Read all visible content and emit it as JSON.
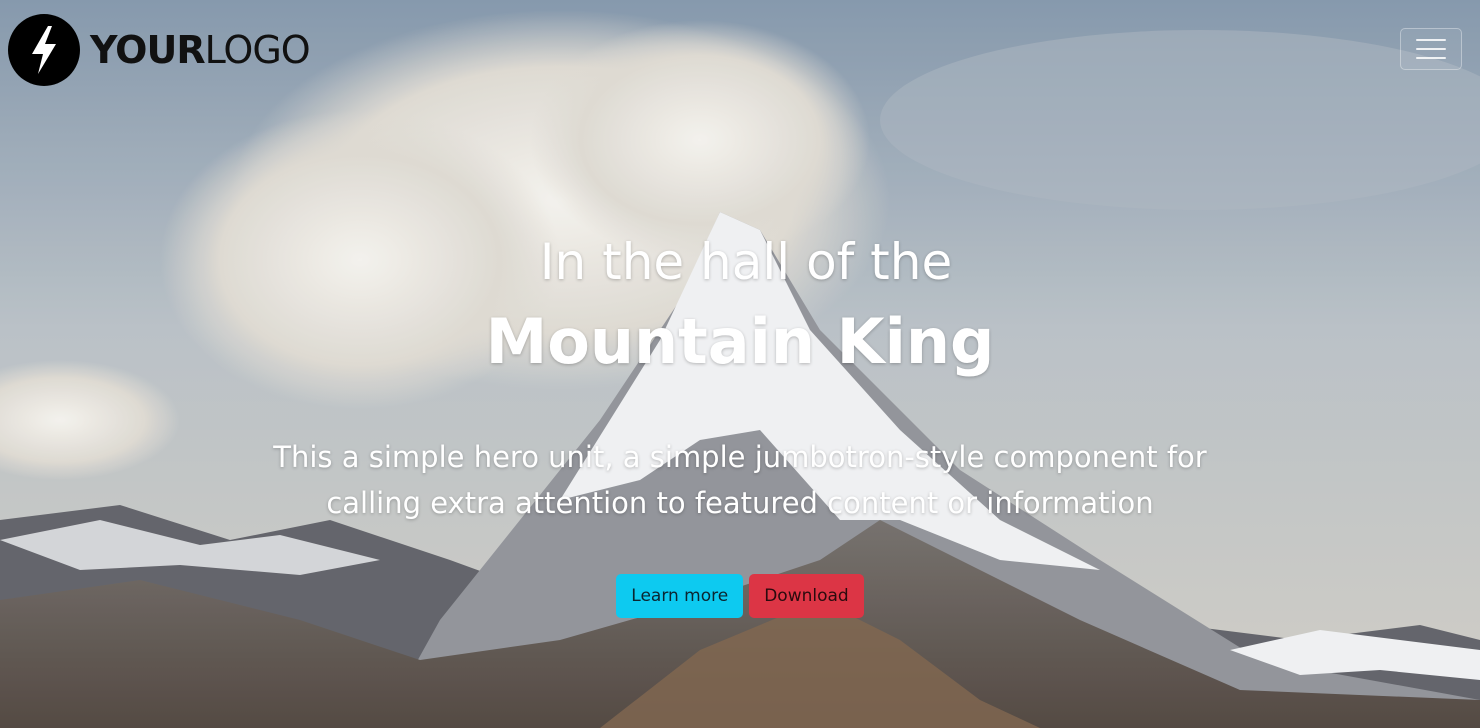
{
  "brand": {
    "logo_strong": "YOUR",
    "logo_light": "LOGO",
    "icon": "lightning-bolt-icon"
  },
  "navbar": {
    "toggler_icon": "hamburger-menu-icon"
  },
  "hero": {
    "kicker": "In the hall of the",
    "title": "Mountain King",
    "lead": "This a simple hero unit, a simple jumbotron-style component for calling extra attention to featured content or information",
    "buttons": {
      "learn_more": "Learn more",
      "download": "Download"
    }
  },
  "colors": {
    "info_button": "#0dcaf0",
    "danger_button": "#dc3545",
    "hero_text": "#ffffff",
    "logo_dark": "#000000"
  }
}
